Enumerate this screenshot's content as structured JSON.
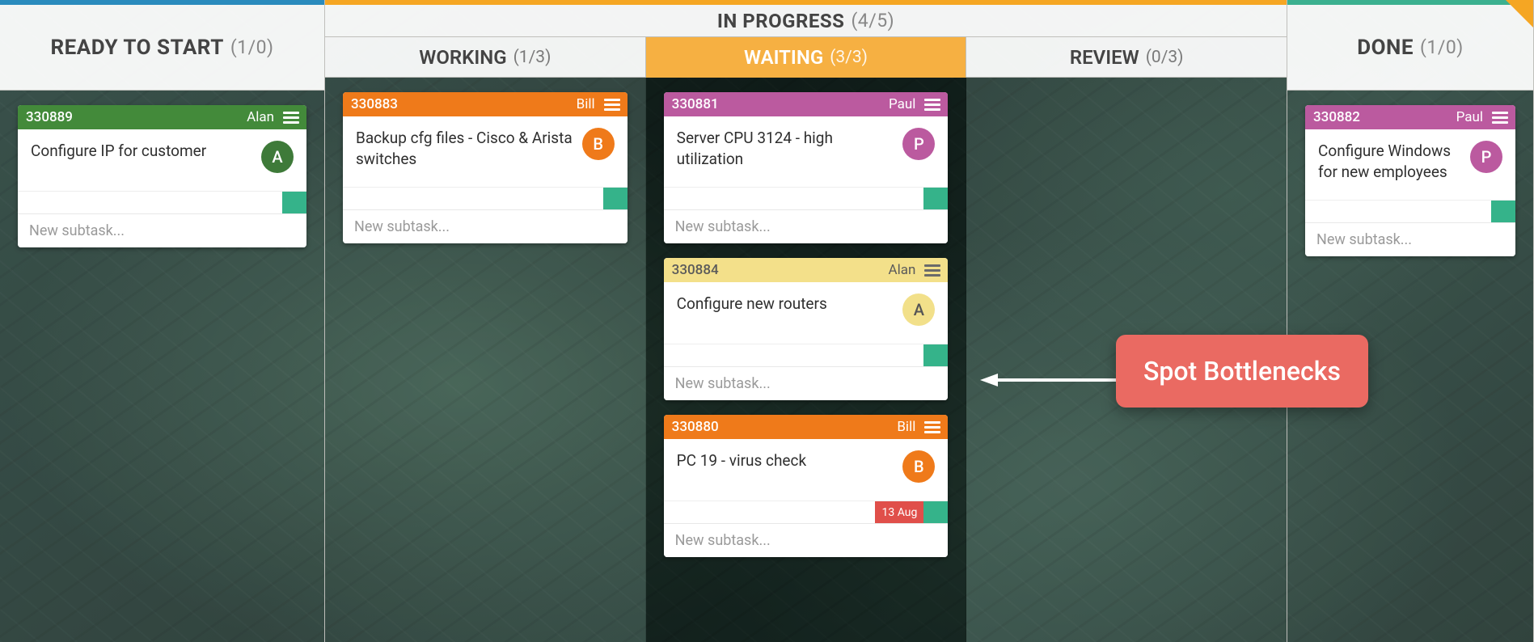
{
  "lanes": {
    "ready": {
      "title": "READY TO START",
      "count": "(1/0)"
    },
    "progress": {
      "title": "IN PROGRESS",
      "count": "(4/5)",
      "sub": {
        "working": {
          "title": "WORKING",
          "count": "(1/3)"
        },
        "waiting": {
          "title": "WAITING",
          "count": "(3/3)"
        },
        "review": {
          "title": "REVIEW",
          "count": "(0/3)"
        }
      }
    },
    "done": {
      "title": "DONE",
      "count": "(1/0)"
    }
  },
  "cards": {
    "ready_0": {
      "id": "330889",
      "assignee": "Alan",
      "title": "Configure IP for customer",
      "avatar": "A"
    },
    "working_0": {
      "id": "330883",
      "assignee": "Bill",
      "title": "Backup cfg files - Cisco & Arista switches",
      "avatar": "B"
    },
    "waiting_0": {
      "id": "330881",
      "assignee": "Paul",
      "title": "Server CPU 3124 - high utilization",
      "avatar": "P"
    },
    "waiting_1": {
      "id": "330884",
      "assignee": "Alan",
      "title": "Configure new routers",
      "avatar": "A"
    },
    "waiting_2": {
      "id": "330880",
      "assignee": "Bill",
      "title": "PC 19 - virus check",
      "avatar": "B",
      "due": "13 Aug"
    },
    "done_0": {
      "id": "330882",
      "assignee": "Paul",
      "title": "Configure Windows for new employees",
      "avatar": "P"
    }
  },
  "subtask_placeholder": "New subtask...",
  "callout": "Spot Bottlenecks"
}
